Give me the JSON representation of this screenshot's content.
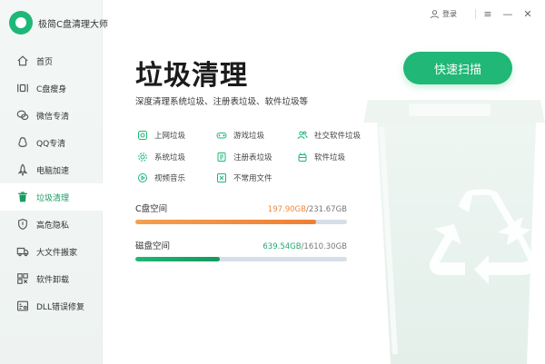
{
  "app": {
    "title": "极简C盘清理大师"
  },
  "topbar": {
    "login_label": "登录",
    "menu_icon": "≡",
    "minimize_icon": "—",
    "close_icon": "✕"
  },
  "sidebar": {
    "items": [
      {
        "label": "首页",
        "icon": "home-icon",
        "active": false
      },
      {
        "label": "C盘瘦身",
        "icon": "disk-slim-icon",
        "active": false
      },
      {
        "label": "微信专清",
        "icon": "wechat-icon",
        "active": false
      },
      {
        "label": "QQ专清",
        "icon": "qq-icon",
        "active": false
      },
      {
        "label": "电脑加速",
        "icon": "rocket-icon",
        "active": false
      },
      {
        "label": "垃圾清理",
        "icon": "trash-icon",
        "active": true
      },
      {
        "label": "高危隐私",
        "icon": "shield-icon",
        "active": false
      },
      {
        "label": "大文件搬家",
        "icon": "truck-icon",
        "active": false
      },
      {
        "label": "软件卸载",
        "icon": "uninstall-icon",
        "active": false
      },
      {
        "label": "DLL错误修复",
        "icon": "dll-icon",
        "active": false
      }
    ]
  },
  "main": {
    "title": "垃圾清理",
    "subtitle": "深度清理系统垃圾、注册表垃圾、软件垃圾等",
    "scan_button": "快速扫描",
    "categories": [
      {
        "label": "上网垃圾",
        "icon": "globe-icon"
      },
      {
        "label": "游戏垃圾",
        "icon": "gamepad-icon"
      },
      {
        "label": "社交软件垃圾",
        "icon": "people-icon"
      },
      {
        "label": "系统垃圾",
        "icon": "gear-icon"
      },
      {
        "label": "注册表垃圾",
        "icon": "registry-icon"
      },
      {
        "label": "软件垃圾",
        "icon": "software-icon"
      },
      {
        "label": "视频音乐",
        "icon": "play-icon"
      },
      {
        "label": "不常用文件",
        "icon": "file-icon"
      }
    ],
    "disks": [
      {
        "name": "C盘空间",
        "used": "197.90GB",
        "total": "/231.67GB",
        "fraction": 0.854
      },
      {
        "name": "磁盘空间",
        "used": "639.54GB",
        "total": "/1610.30GB",
        "fraction": 0.397
      }
    ]
  },
  "colors": {
    "accent": "#21b776",
    "warning": "#f08a3a"
  }
}
